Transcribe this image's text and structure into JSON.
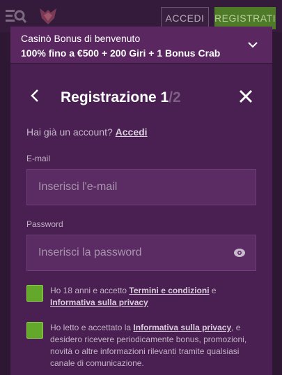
{
  "header": {
    "login_label": "ACCEDI",
    "register_label": "REGISTRATI"
  },
  "banner": {
    "line1": "Casinò Bonus di benvenuto",
    "line2": "100% fino a €500 + 200 Giri + 1 Bonus Crab"
  },
  "modal": {
    "title": "Registrazione 1",
    "step_total": "/2",
    "have_account_text": "Hai già un account?",
    "login_link": "Accedi",
    "email": {
      "label": "E-mail",
      "placeholder": "Inserisci l'e-mail",
      "value": ""
    },
    "password": {
      "label": "Password",
      "placeholder": "Inserisci la password",
      "value": ""
    },
    "consent_age": {
      "text_before": "Ho 18 anni e accetto ",
      "link1": "Termini e condizioni",
      "text_mid": " e ",
      "link2": "Informativa sulla privacy"
    },
    "consent_marketing": {
      "text_before": "Ho letto e accettato la ",
      "link": "Informativa sulla privacy",
      "text_after": ", e desidero ricevere periodicamente bonus, promozioni, novità o altre informazioni rilevanti tramite qualsiasi canale di comunicazione."
    }
  },
  "colors": {
    "background": "#2e1733",
    "modal": "#4a1f51",
    "banner": "#5a2760",
    "input": "#5b2c63",
    "checkbox": "#63a82a",
    "register_button": "#4f7a28"
  }
}
